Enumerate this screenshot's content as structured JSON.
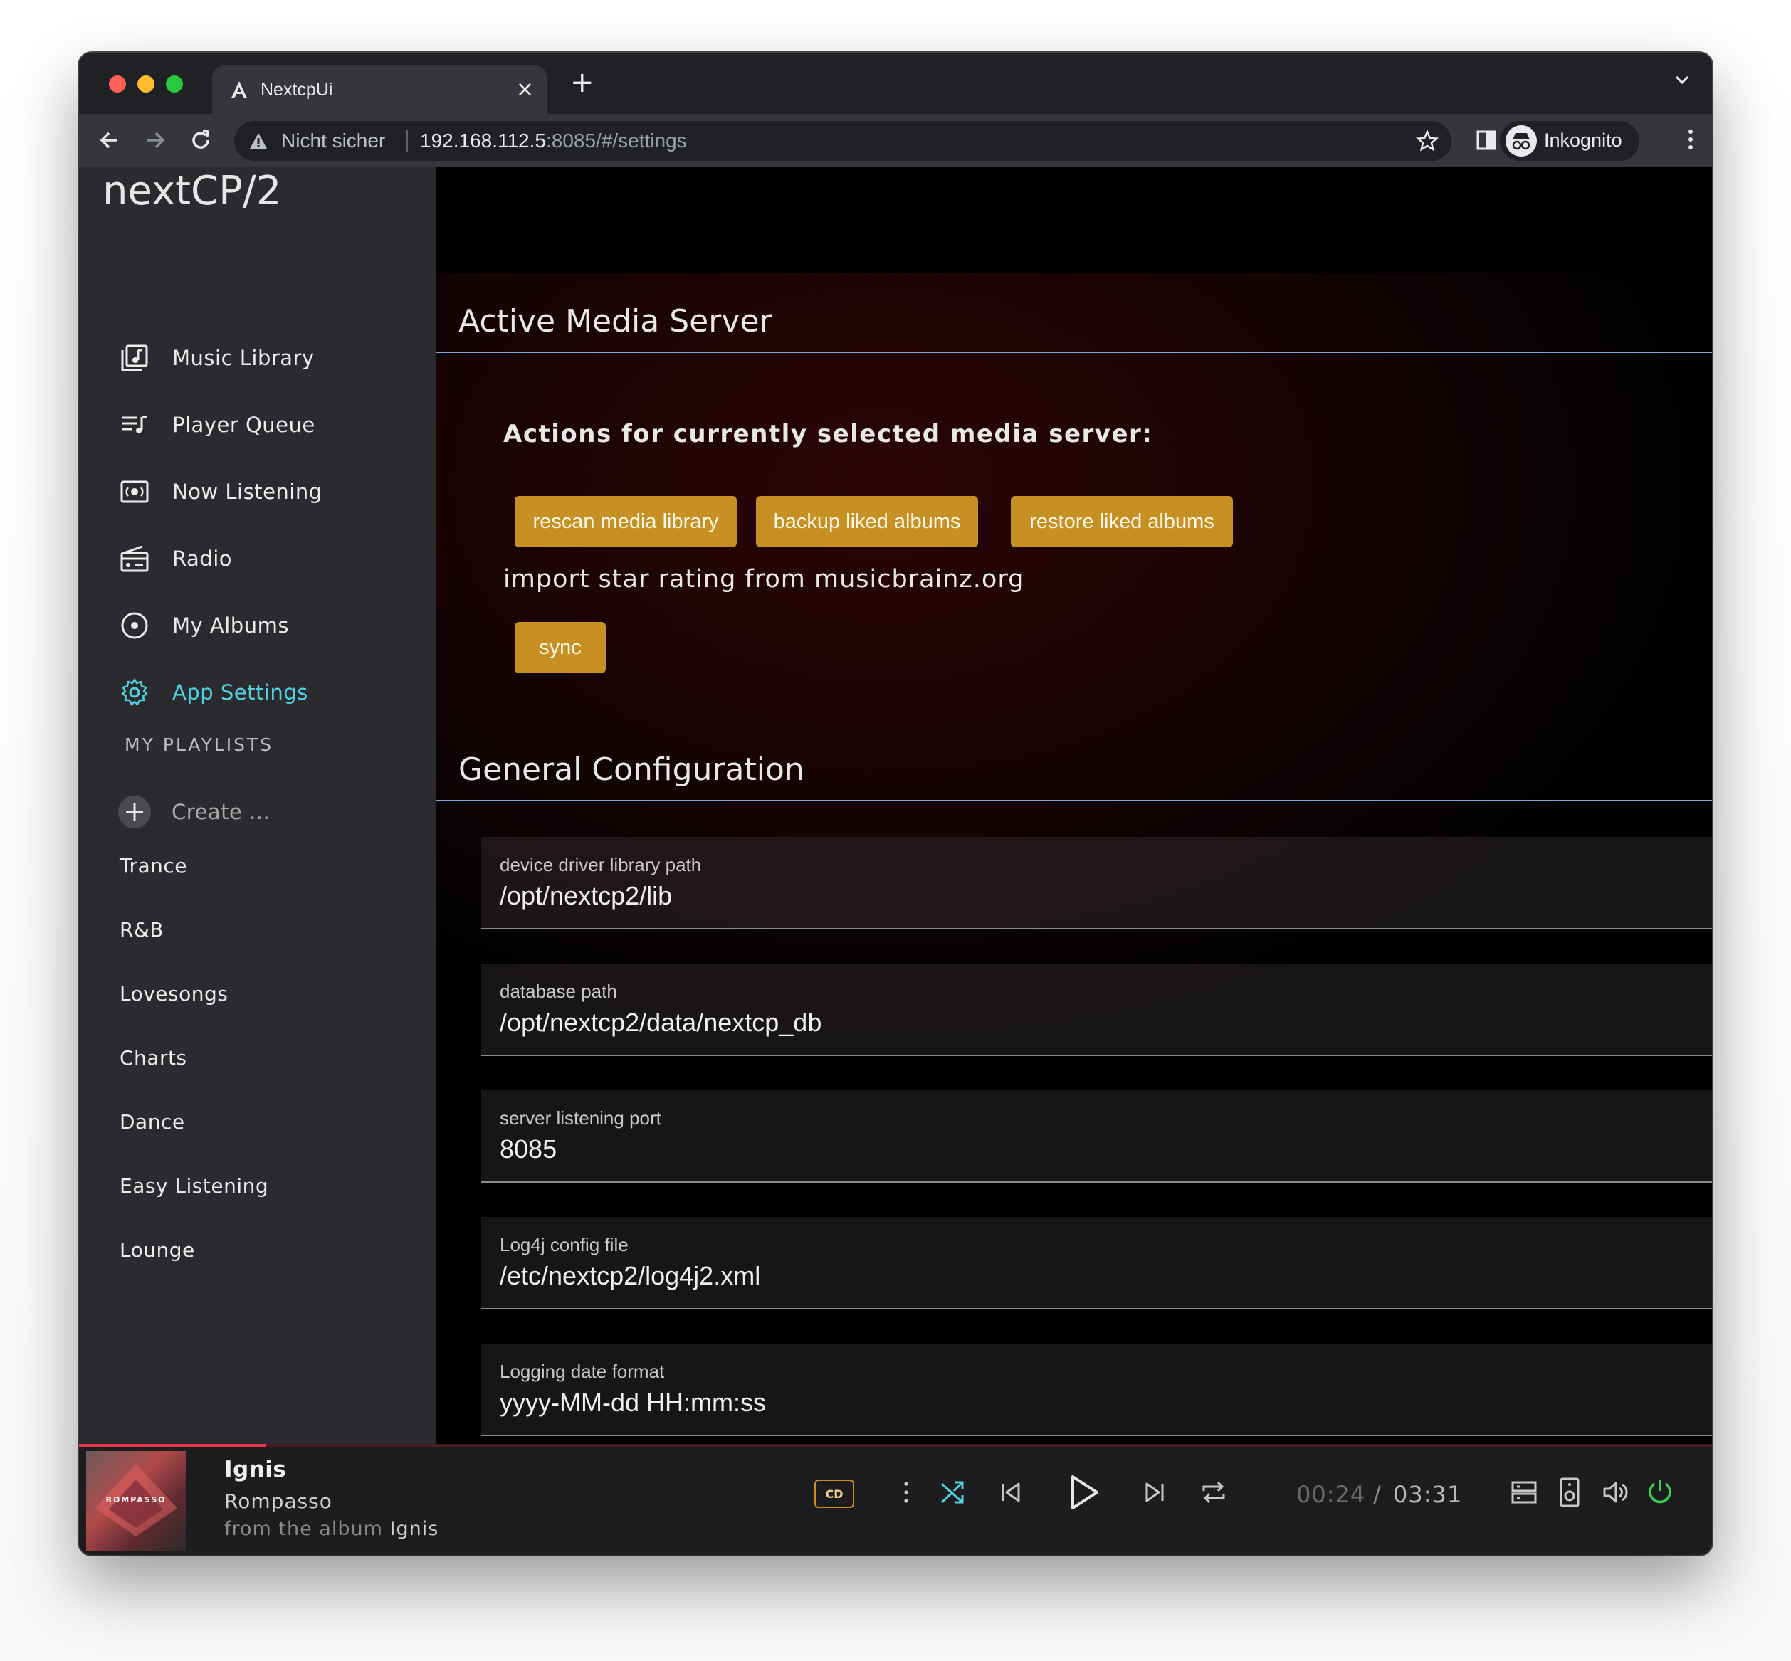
{
  "browser": {
    "tab_title": "NextcpUi",
    "tab_close": "×",
    "new_tab": "+",
    "omnibox": {
      "security_label": "Nicht sicher",
      "url_host": "192.168.112.5",
      "url_rest": ":8085/#/settings"
    },
    "profile_label": "Inkognito"
  },
  "sidebar": {
    "brand": "nextCP/2",
    "nav": [
      {
        "label": "Music Library",
        "icon": "library-music-icon"
      },
      {
        "label": "Player Queue",
        "icon": "queue-music-icon"
      },
      {
        "label": "Now Listening",
        "icon": "now-listening-icon"
      },
      {
        "label": "Radio",
        "icon": "radio-icon"
      },
      {
        "label": "My Albums",
        "icon": "album-icon"
      },
      {
        "label": "App Settings",
        "icon": "gear-icon",
        "active": true
      }
    ],
    "playlists_heading": "MY PLAYLISTS",
    "create_label": "Create ...",
    "playlists": [
      "Trance",
      "R&B",
      "Lovesongs",
      "Charts",
      "Dance",
      "Easy Listening",
      "Lounge"
    ]
  },
  "main": {
    "active_server": {
      "title": "Active Media Server",
      "actions_heading": "Actions for currently selected media server:",
      "buttons": [
        "rescan media library",
        "backup liked albums",
        "restore liked albums"
      ],
      "import_label": "import star rating from musicbrainz.org",
      "sync_label": "sync"
    },
    "general": {
      "title": "General Configuration",
      "fields": [
        {
          "label": "device driver library path",
          "value": "/opt/nextcp2/lib"
        },
        {
          "label": "database path",
          "value": "/opt/nextcp2/data/nextcp_db"
        },
        {
          "label": "server listening port",
          "value": "8085"
        },
        {
          "label": "Log4j config file",
          "value": "/etc/nextcp2/log4j2.xml"
        },
        {
          "label": "Logging date format",
          "value": "yyyy-MM-dd HH:mm:ss"
        }
      ]
    }
  },
  "player": {
    "title": "Ignis",
    "artist": "Rompasso",
    "album_prefix": "from the album",
    "album": "Ignis",
    "cover_text": "ROMPASSO",
    "cd_badge": "CD",
    "elapsed": "00:24",
    "time_sep": "/",
    "duration": "03:31",
    "progress_fraction": 0.114,
    "colors": {
      "accent": "#4fd2de",
      "button": "#c79024",
      "progress": "#e8384f",
      "power": "#3ccf4e"
    }
  }
}
